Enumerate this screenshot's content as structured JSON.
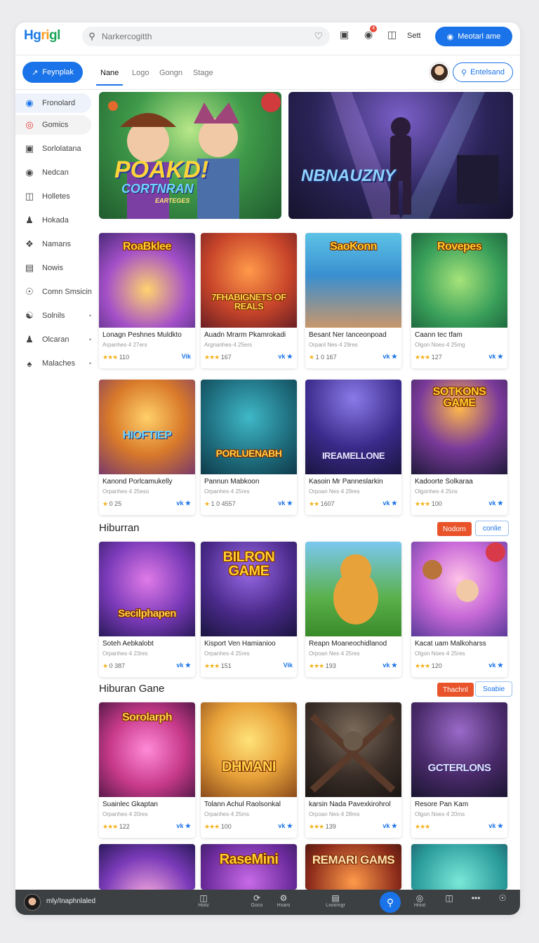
{
  "app": {
    "logo": [
      "Hg",
      "ri",
      "gl"
    ]
  },
  "search": {
    "placeholder": "Narkercogitth"
  },
  "topbar": {
    "badge": "4",
    "settings_label": "Sett",
    "primary_label": "Meotarl ame"
  },
  "navbar": {
    "primary_button": "Feynplak",
    "tabs": [
      "Nane",
      "Logo",
      "Gongn",
      "Stage"
    ],
    "outline_button": "Entelsand"
  },
  "sidebar": {
    "items": [
      {
        "label": "Fronolard",
        "icon": "globe-icon"
      },
      {
        "label": "Gomics",
        "icon": "target-icon"
      },
      {
        "label": "Sorlolatana",
        "icon": "tv-icon"
      },
      {
        "label": "Nedcan",
        "icon": "record-icon"
      },
      {
        "label": "Holletes",
        "icon": "columns-icon"
      },
      {
        "label": "Hokada",
        "icon": "person-icon"
      },
      {
        "label": "Namans",
        "icon": "puzzle-icon"
      },
      {
        "label": "Nowis",
        "icon": "news-icon"
      },
      {
        "label": "Comn Smsicin",
        "icon": "circle-icon"
      },
      {
        "label": "Solnils",
        "icon": "network-icon",
        "bullet": "•"
      },
      {
        "label": "Olcaran",
        "icon": "person-icon",
        "bullet": "•"
      },
      {
        "label": "Malaches",
        "icon": "group-icon",
        "bullet": "•"
      }
    ]
  },
  "banners": [
    {
      "title": "POAKD!",
      "subtitle": "CORTNRAN",
      "small": "EARTEGES"
    },
    {
      "title": "NBNAUZNY"
    }
  ],
  "grid1": [
    {
      "art": "RoaBklee",
      "name": "Lonagn Peshnes Muldkto",
      "sub": "Arpanhes·4 27ers",
      "rating": "110",
      "stars": "★★★",
      "tag": "Vik"
    },
    {
      "art": "7FHABIGNETS OF REALS",
      "name": "Auadn Mrarm Pkamrokadi",
      "sub": "Argnanhes·4 25ers",
      "rating": "167",
      "stars": "★★★",
      "tag": "vk ★"
    },
    {
      "art": "SaoKonn",
      "name": "Besant Ner Ianceonpoad",
      "sub": "Orpanl Nes·4 29res",
      "rating": "1 0 167",
      "stars": "★",
      "tag": "vk ★"
    },
    {
      "art": "Rovepes",
      "name": "Caann tec tfam",
      "sub": "Olgon Noes·4 25mg",
      "rating": "127",
      "stars": "★★★",
      "tag": "vk ★"
    }
  ],
  "grid2": [
    {
      "art": "HIOFTIEP",
      "name": "Kanond Porlcamukelly",
      "sub": "Orpanhes·4 25eso",
      "rating": "0 25",
      "stars": "★",
      "tag": "vk ★"
    },
    {
      "art": "PORLUENABH",
      "name": "Pannun Mabkoon",
      "sub": "Orpanhes·4 25res",
      "rating": "1 0 4557",
      "stars": "★",
      "tag": "vk ★"
    },
    {
      "art": "IREAMELLONE",
      "name": "Kasoin Mr Panneslarkin",
      "sub": "Orpoan Nes·4 29res",
      "rating": "1607",
      "stars": "★★",
      "tag": "vk ★"
    },
    {
      "art": "SOTKONS GAME",
      "name": "Kadoorte Solkaraa",
      "sub": "Olgonhes·4 25ns",
      "rating": "100",
      "stars": "★★★",
      "tag": "vk ★"
    }
  ],
  "section1": {
    "title": "Hiburran",
    "red": "Nodorn",
    "outline": "conlie"
  },
  "grid3": [
    {
      "art": "Secilphapen",
      "name": "Soteh Aebkalobt",
      "sub": "Orpanhes·4 23res",
      "rating": "0 387",
      "stars": "★",
      "tag": "vk ★"
    },
    {
      "art": "BILRON GAME",
      "name": "Kisport Ven Hamianioo",
      "sub": "Orpanhes·4 25res",
      "rating": "151",
      "stars": "★★★",
      "tag": "Vik"
    },
    {
      "art": "",
      "name": "Reapn Moaneochidlanod",
      "sub": "Orpoan Nes·4 25res",
      "rating": "193",
      "stars": "★★★",
      "tag": "vk ★"
    },
    {
      "art": "",
      "name": "Kacat uam Malkoharss",
      "sub": "Olgon Noes·4 25res",
      "rating": "120",
      "stars": "★★★",
      "tag": "vk ★"
    }
  ],
  "section2": {
    "title": "Hiburan Gane",
    "red": "Thachnl",
    "outline": "Soabie"
  },
  "grid4": [
    {
      "art": "Sorolarph",
      "name": "Suainlec Gkaptan",
      "sub": "Orpanhes·4 20res",
      "rating": "122",
      "stars": "★★★",
      "tag": "vk ★"
    },
    {
      "art": "DHMANI",
      "name": "Tolann Achul Raolsonkal",
      "sub": "Orpanhes·4 25ms",
      "rating": "100",
      "stars": "★★★",
      "tag": "vk ★"
    },
    {
      "art": "",
      "name": "karsin Nada Pavexkirohrol",
      "sub": "Orpoan Nes·4 28res",
      "rating": "139",
      "stars": "★★★",
      "tag": "vk ★"
    },
    {
      "art": "GCTERLONS",
      "name": "Resore Pan Kam",
      "sub": "Olgon Noes·4 20ms",
      "rating": "",
      "stars": "★★★",
      "tag": "vk ★"
    }
  ],
  "grid5": [
    {
      "art": ""
    },
    {
      "art": "RaseMini"
    },
    {
      "art": "REMARI GAMS"
    },
    {
      "art": ""
    }
  ],
  "bottombar": {
    "label": "mly/Inaphnlaled",
    "items": [
      {
        "icon": "grid-icon",
        "label": "Hoiiz"
      },
      {
        "icon": "refresh-icon",
        "label": "Goco"
      },
      {
        "icon": "gear-icon",
        "label": "Hxaro"
      },
      {
        "icon": "clipboard-icon",
        "label": "Lxoorogr"
      },
      {
        "icon": "chat-icon",
        "label": "Hniot"
      },
      {
        "icon": "book-icon",
        "label": ""
      },
      {
        "icon": "more-icon",
        "label": ""
      },
      {
        "icon": "help-icon",
        "label": ""
      }
    ]
  }
}
